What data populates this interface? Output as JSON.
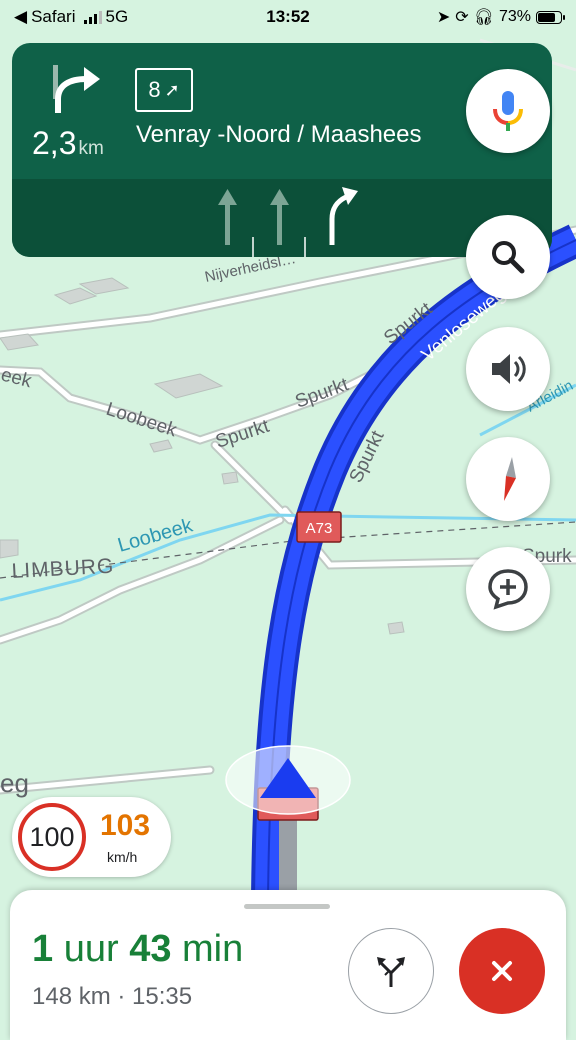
{
  "status_bar": {
    "back_app": "Safari",
    "network": "5G",
    "time": "13:52",
    "battery": "73%",
    "battery_level": 0.73
  },
  "maneuver": {
    "distance": "2,3",
    "distance_unit": "km",
    "exit_number": "8",
    "destination": "Venray -Noord / Maashees",
    "icon": "turn-slight-right-icon"
  },
  "lanes": [
    {
      "icon": "lane-straight-icon",
      "active": false
    },
    {
      "icon": "lane-straight-icon",
      "active": false
    },
    {
      "icon": "lane-slight-right-icon",
      "active": true
    }
  ],
  "map_labels": {
    "road_top": "Nijverheidsl…",
    "highway_name": "Venloseweg",
    "spurkt": "Spurkt",
    "loobeek": "Loobeek",
    "limburg": "LIMBURG",
    "arleidin": "Arleidin",
    "a73": "A73",
    "eg": "eg",
    "spurk_right": "Spurk"
  },
  "controls": {
    "mic": "mic-icon",
    "search": "search-icon",
    "sound": "speaker-icon",
    "compass": "compass-icon",
    "report": "add-report-icon"
  },
  "speed": {
    "limit": "100",
    "current": "103",
    "unit": "km/h"
  },
  "trip": {
    "hours": "1",
    "hours_label": "uur",
    "minutes": "43",
    "minutes_label": "min",
    "distance": "148 km",
    "separator": "·",
    "arrival": "15:35"
  },
  "colors": {
    "nav_green": "#0f6148",
    "route_blue": "#1a3cf0",
    "eta_green": "#188038",
    "exit_red": "#d93025",
    "map_bg": "#d6f3e0"
  }
}
